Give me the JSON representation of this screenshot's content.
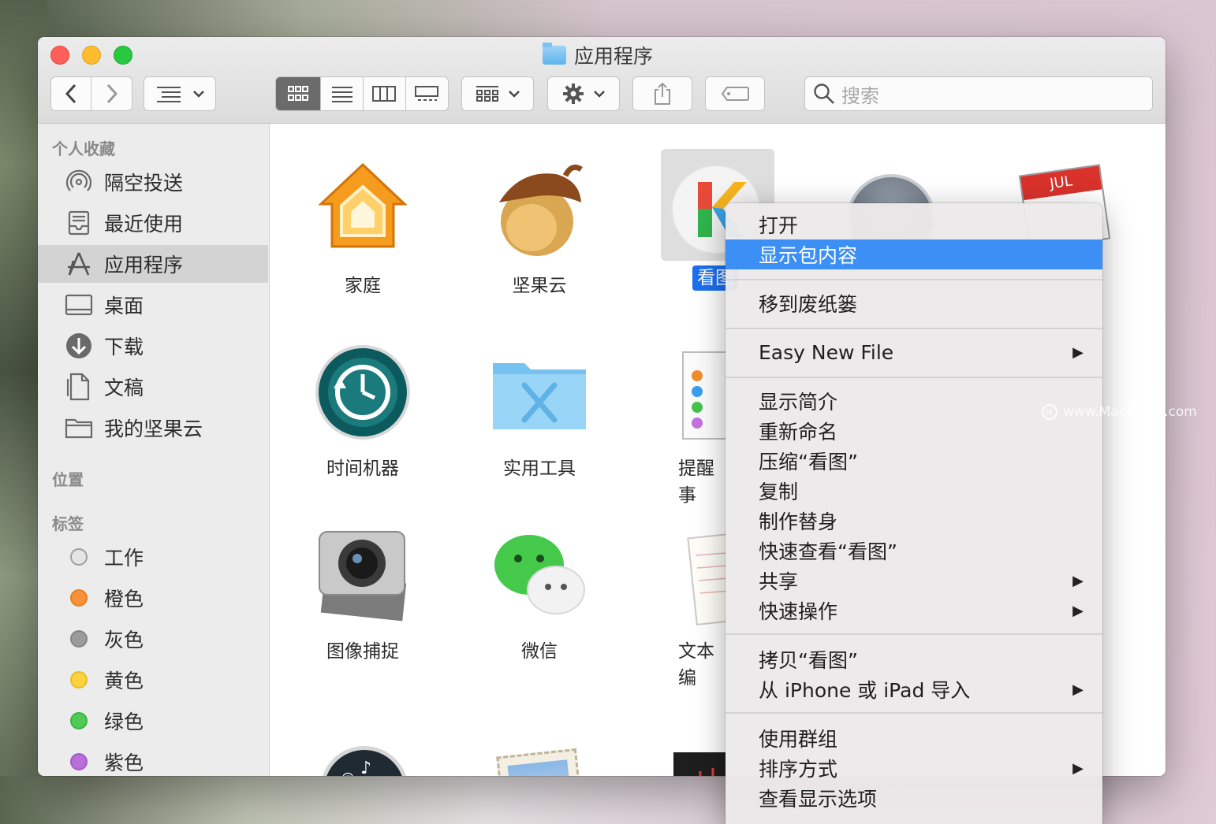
{
  "window": {
    "title": "应用程序"
  },
  "toolbar": {
    "back_glyph": "‹",
    "forward_glyph": "›",
    "search_placeholder": "搜索"
  },
  "sidebar": {
    "favorites_heading": "个人收藏",
    "items": [
      {
        "label": "隔空投送",
        "icon": "airdrop-icon"
      },
      {
        "label": "最近使用",
        "icon": "recents-icon"
      },
      {
        "label": "应用程序",
        "icon": "applications-icon",
        "selected": true
      },
      {
        "label": "桌面",
        "icon": "desktop-icon"
      },
      {
        "label": "下载",
        "icon": "downloads-icon"
      },
      {
        "label": "文稿",
        "icon": "documents-icon"
      },
      {
        "label": "我的坚果云",
        "icon": "folder-icon"
      }
    ],
    "locations_heading": "位置",
    "tags_heading": "标签",
    "tags": [
      {
        "label": "工作",
        "color": "#e4e4e4"
      },
      {
        "label": "橙色",
        "color": "#f7923a"
      },
      {
        "label": "灰色",
        "color": "#9b9a9c"
      },
      {
        "label": "黄色",
        "color": "#fdd33b"
      },
      {
        "label": "绿色",
        "color": "#4fcb55"
      },
      {
        "label": "紫色",
        "color": "#b86fd8"
      }
    ]
  },
  "apps": [
    {
      "label": "家庭",
      "icon": "home-app-icon"
    },
    {
      "label": "坚果云",
      "icon": "nutstore-app-icon"
    },
    {
      "label": "看图",
      "icon": "kantu-app-icon",
      "selected": true
    },
    {
      "label": "时间机器",
      "icon": "time-machine-icon"
    },
    {
      "label": "实用工具",
      "icon": "utilities-folder-icon"
    },
    {
      "label": "提醒事",
      "icon": "reminders-icon"
    },
    {
      "label": "图像捕捉",
      "icon": "image-capture-icon"
    },
    {
      "label": "微信",
      "icon": "wechat-icon"
    },
    {
      "label": "文本编",
      "icon": "textedit-icon"
    }
  ],
  "context_menu": {
    "groups": [
      [
        {
          "label": "打开"
        },
        {
          "label": "显示包内容",
          "highlighted": true
        }
      ],
      [
        {
          "label": "移到废纸篓"
        }
      ],
      [
        {
          "label": "Easy New File",
          "submenu": true
        }
      ],
      [
        {
          "label": "显示简介"
        },
        {
          "label": "重新命名"
        },
        {
          "label": "压缩“看图”"
        },
        {
          "label": "复制"
        },
        {
          "label": "制作替身"
        },
        {
          "label": "快速查看“看图”"
        },
        {
          "label": "共享",
          "submenu": true
        },
        {
          "label": "快速操作",
          "submenu": true
        }
      ],
      [
        {
          "label": "拷贝“看图”"
        },
        {
          "label": "从 iPhone 或 iPad 导入",
          "submenu": true
        }
      ],
      [
        {
          "label": "使用群组"
        },
        {
          "label": "排序方式",
          "submenu": true
        },
        {
          "label": "查看显示选项"
        }
      ]
    ],
    "submenu_arrow": "▶"
  },
  "calendar_icon_month": "JUL",
  "watermark": "www.MacDown.com"
}
